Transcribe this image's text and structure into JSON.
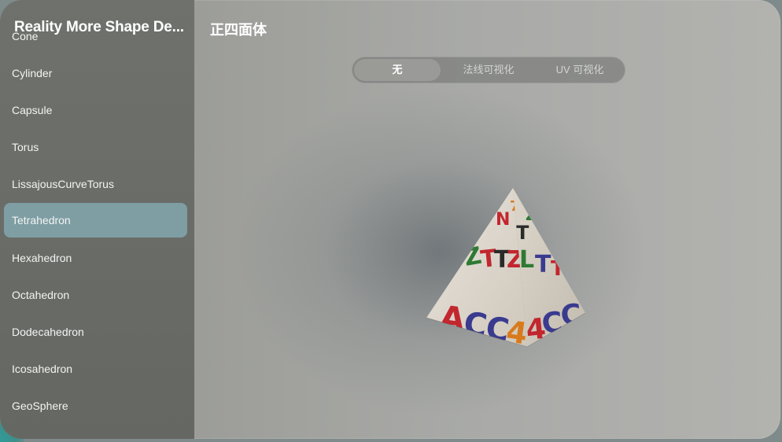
{
  "app": {
    "title": "Reality More Shape De..."
  },
  "sidebar": {
    "items": [
      {
        "label": "Cone",
        "selected": false
      },
      {
        "label": "Cylinder",
        "selected": false
      },
      {
        "label": "Capsule",
        "selected": false
      },
      {
        "label": "Torus",
        "selected": false
      },
      {
        "label": "LissajousCurveTorus",
        "selected": false
      },
      {
        "label": "Tetrahedron",
        "selected": true
      },
      {
        "label": "Hexahedron",
        "selected": false
      },
      {
        "label": "Octahedron",
        "selected": false
      },
      {
        "label": "Dodecahedron",
        "selected": false
      },
      {
        "label": "Icosahedron",
        "selected": false
      },
      {
        "label": "GeoSphere",
        "selected": false
      }
    ]
  },
  "main": {
    "title": "正四面体",
    "segments": [
      {
        "label": "无",
        "active": true
      },
      {
        "label": "法线可视化",
        "active": false
      },
      {
        "label": "UV 可视化",
        "active": false
      }
    ]
  },
  "colors": {
    "sidebar_bg": "#6b6d69",
    "selection": "#7e9ea4",
    "text": "#ffffff"
  }
}
